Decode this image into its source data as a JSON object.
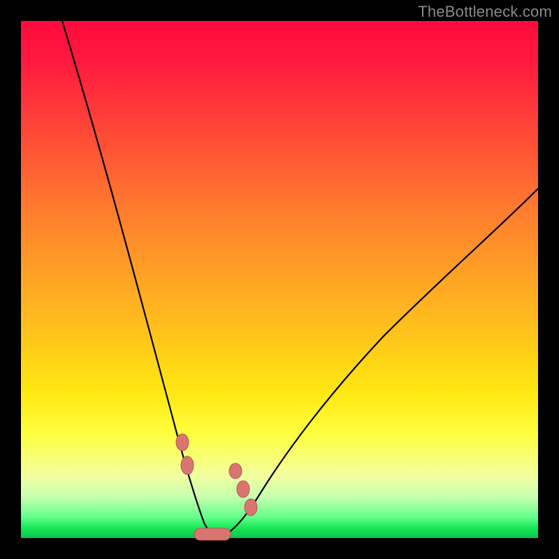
{
  "watermark": "TheBottleneck.com",
  "colors": {
    "gradient_top": "#ff0a3e",
    "gradient_mid1": "#ff7a2e",
    "gradient_mid2": "#ffe812",
    "gradient_bottom": "#0cc44a",
    "curve": "#000000",
    "beads": "#d97570",
    "frame_bg": "#000000"
  },
  "chart_data": {
    "type": "line",
    "title": "",
    "xlabel": "",
    "ylabel": "",
    "xlim": [
      0,
      100
    ],
    "ylim": [
      0,
      100
    ],
    "grid": false,
    "background_gradient": {
      "direction": "vertical",
      "stops": [
        {
          "pos": 0.0,
          "color": "#ff0a3e"
        },
        {
          "pos": 0.36,
          "color": "#ff7a2e"
        },
        {
          "pos": 0.72,
          "color": "#ffe812"
        },
        {
          "pos": 0.96,
          "color": "#62ff8a"
        },
        {
          "pos": 1.0,
          "color": "#0cc44a"
        }
      ]
    },
    "series": [
      {
        "name": "left-branch",
        "x": [
          8,
          12,
          16,
          20,
          24,
          27,
          29,
          31,
          33,
          35,
          37
        ],
        "y": [
          100,
          83,
          67,
          51,
          36,
          24,
          16,
          10,
          5,
          2,
          0
        ]
      },
      {
        "name": "right-branch",
        "x": [
          37,
          40,
          43,
          46,
          50,
          56,
          64,
          74,
          86,
          100
        ],
        "y": [
          0,
          1,
          3,
          6,
          10,
          18,
          29,
          42,
          55,
          68
        ]
      }
    ],
    "markers": [
      {
        "name": "bead-left-upper",
        "x": 31.2,
        "y": 18.5
      },
      {
        "name": "bead-left-lower",
        "x": 32.2,
        "y": 14.0
      },
      {
        "name": "bead-right-a",
        "x": 41.5,
        "y": 13.0
      },
      {
        "name": "bead-right-b",
        "x": 43.0,
        "y": 9.5
      },
      {
        "name": "bead-right-c",
        "x": 44.5,
        "y": 6.0
      }
    ],
    "bottom_bar": {
      "x_start": 33.5,
      "x_end": 40.5,
      "y": 0.5
    }
  }
}
